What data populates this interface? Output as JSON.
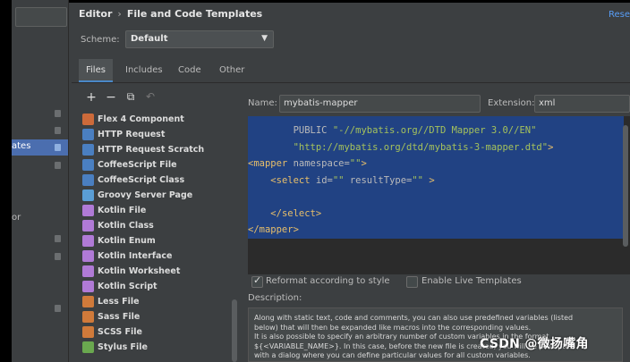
{
  "header": {
    "breadcrumb_parent": "Editor",
    "breadcrumb_current": "File and Code Templates",
    "reset_label": "Reset"
  },
  "sidebar": {
    "selected_label": "ates",
    "bottom_label": "or"
  },
  "scheme": {
    "label": "Scheme:",
    "value": "Default"
  },
  "tabs": [
    {
      "label": "Files",
      "active": true
    },
    {
      "label": "Includes"
    },
    {
      "label": "Code"
    },
    {
      "label": "Other"
    }
  ],
  "toolbar": {
    "add": "+",
    "remove": "−",
    "copy": "⧉",
    "reset": "↶"
  },
  "templates": [
    {
      "label": "Flex 4 Component",
      "icon_color": "#cc6a3a",
      "icon": "flex-icon"
    },
    {
      "label": "HTTP Request",
      "icon_color": "#4a7fc1",
      "icon": "http-icon"
    },
    {
      "label": "HTTP Request Scratch",
      "icon_color": "#4a7fc1",
      "icon": "http-icon"
    },
    {
      "label": "CoffeeScript File",
      "icon_color": "#4a7fc1",
      "icon": "coffeescript-icon"
    },
    {
      "label": "CoffeeScript Class",
      "icon_color": "#4a7fc1",
      "icon": "coffeescript-icon"
    },
    {
      "label": "Groovy Server Page",
      "icon_color": "#5a9ed6",
      "icon": "groovy-icon"
    },
    {
      "label": "Kotlin File",
      "icon_color": "#b07ad6",
      "icon": "kotlin-icon"
    },
    {
      "label": "Kotlin Class",
      "icon_color": "#b07ad6",
      "icon": "kotlin-icon"
    },
    {
      "label": "Kotlin Enum",
      "icon_color": "#b07ad6",
      "icon": "kotlin-icon"
    },
    {
      "label": "Kotlin Interface",
      "icon_color": "#b07ad6",
      "icon": "kotlin-icon"
    },
    {
      "label": "Kotlin Worksheet",
      "icon_color": "#b07ad6",
      "icon": "kotlin-icon"
    },
    {
      "label": "Kotlin Script",
      "icon_color": "#b07ad6",
      "icon": "kotlin-icon"
    },
    {
      "label": "Less File",
      "icon_color": "#d07a3a",
      "icon": "less-icon"
    },
    {
      "label": "Sass File",
      "icon_color": "#d07a3a",
      "icon": "sass-icon"
    },
    {
      "label": "SCSS File",
      "icon_color": "#d07a3a",
      "icon": "scss-icon"
    },
    {
      "label": "Stylus File",
      "icon_color": "#6aa84f",
      "icon": "stylus-icon"
    }
  ],
  "editor": {
    "name_label": "Name:",
    "name_value": "mybatis-mapper",
    "extension_label": "Extension:",
    "extension_value": "xml",
    "code_lines": [
      {
        "indent": "        ",
        "parts": [
          {
            "t": "PUBLIC ",
            "c": "att"
          },
          {
            "t": "\"-//mybatis.org//DTD Mapper 3.0//EN\"",
            "c": "str"
          }
        ]
      },
      {
        "indent": "        ",
        "parts": [
          {
            "t": "\"http://mybatis.org/dtd/mybatis-3-mapper.dtd\"",
            "c": "str"
          },
          {
            "t": ">",
            "c": "tag"
          }
        ]
      },
      {
        "indent": "",
        "parts": [
          {
            "t": "<mapper ",
            "c": "tag"
          },
          {
            "t": "namespace=",
            "c": "att"
          },
          {
            "t": "\"\"",
            "c": "str"
          },
          {
            "t": ">",
            "c": "tag"
          }
        ]
      },
      {
        "indent": "    ",
        "parts": [
          {
            "t": "<select ",
            "c": "tag"
          },
          {
            "t": "id=",
            "c": "att"
          },
          {
            "t": "\"\" ",
            "c": "str"
          },
          {
            "t": "resultType=",
            "c": "att"
          },
          {
            "t": "\"\" ",
            "c": "str"
          },
          {
            "t": ">",
            "c": "tag"
          }
        ]
      },
      {
        "indent": "",
        "parts": []
      },
      {
        "indent": "    ",
        "parts": [
          {
            "t": "</select>",
            "c": "tag"
          }
        ]
      },
      {
        "indent": "",
        "parts": [
          {
            "t": "</mapper>",
            "c": "tag"
          }
        ]
      }
    ]
  },
  "options": {
    "reformat_label": "Reformat according to style",
    "reformat_checked": true,
    "live_templates_label": "Enable Live Templates",
    "live_templates_checked": false
  },
  "description": {
    "label": "Description:",
    "text_lines": [
      "Along with static text, code and comments, you can also use predefined variables (listed",
      "below) that will then be expanded like macros into the corresponding values.",
      "It is also possible to specify an arbitrary number of custom variables in the format",
      "${<VARIABLE_NAME>}. In this case, before the new file is created, you will be prompted",
      "with a dialog where you can define particular values for all custom variables."
    ]
  },
  "watermark": "CSDN @微扬嘴角"
}
